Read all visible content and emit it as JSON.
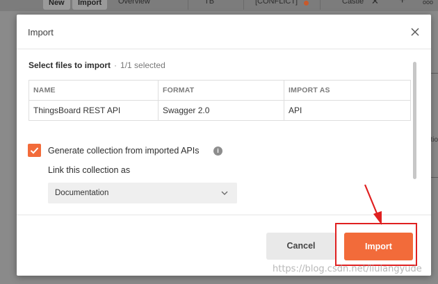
{
  "background": {
    "new_label": "New",
    "import_label": "Import",
    "overview_tab": "Overview",
    "tb_tab": "TB",
    "conflict_tab": "[CONFLICT]",
    "castle_tab": "Castle",
    "plus_label": "+",
    "more_label": "ooo",
    "right_side_text": "tio"
  },
  "modal": {
    "title": "Import",
    "select_files_title": "Select files to import",
    "separator": "·",
    "selected_count": "1/1 selected",
    "table": {
      "headers": [
        "NAME",
        "FORMAT",
        "IMPORT AS"
      ],
      "rows": [
        [
          "ThingsBoard REST API",
          "Swagger 2.0",
          "API"
        ]
      ]
    },
    "generate_collection_label": "Generate collection from imported APIs",
    "generate_collection_checked": true,
    "info_icon_label": "i",
    "link_collection_label": "Link this collection as",
    "link_collection_value": "Documentation",
    "cancel_label": "Cancel",
    "import_label": "Import"
  },
  "watermark": "https://blog.csdn.net/liulangyude",
  "colors": {
    "accent": "#f26b3a",
    "annotation_red": "#e02020",
    "overlay": "#8a8a8a"
  }
}
